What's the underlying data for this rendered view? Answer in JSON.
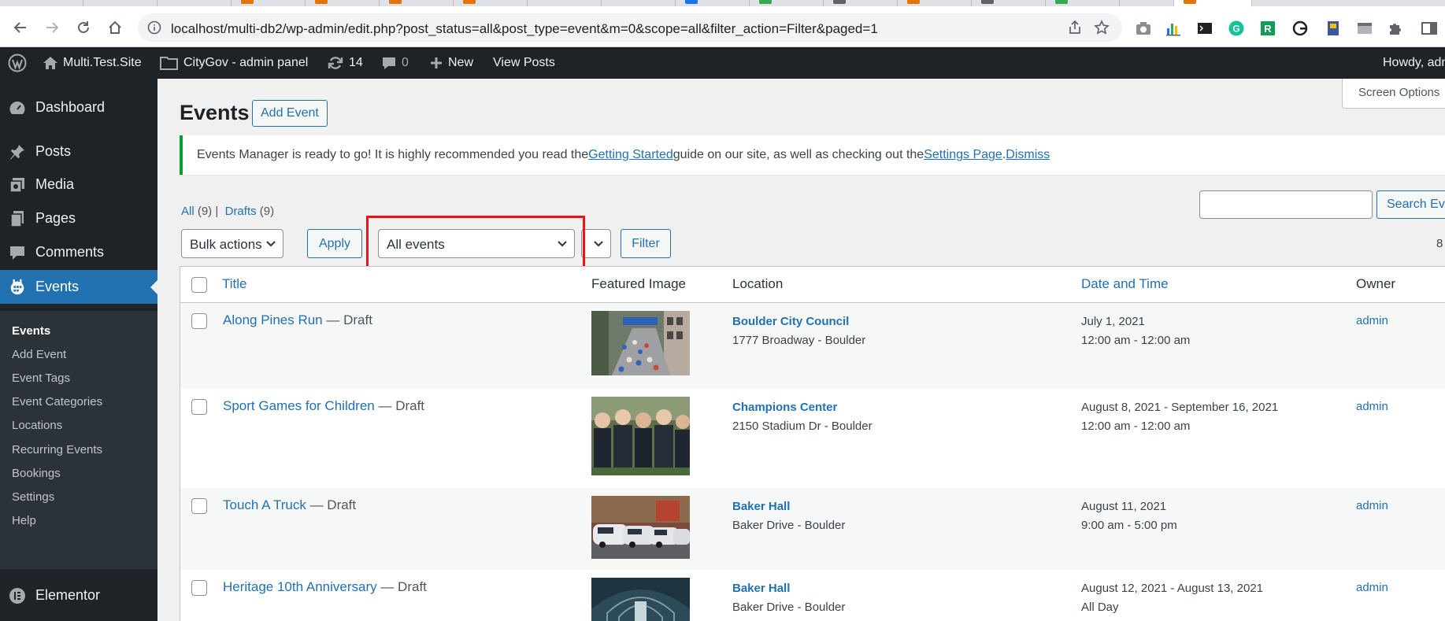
{
  "browser": {
    "url": "localhost/multi-db2/wp-admin/edit.php?post_status=all&post_type=event&m=0&scope=all&filter_action=Filter&paged=1",
    "tab_favicon_colors": [
      "#e37400",
      "#e37400",
      "#e37400",
      "#e37400",
      "#1a73e8",
      "#1a73e8",
      "#34a853",
      "#5f6368",
      "#e37400",
      "#e37400",
      "#5f6368",
      "#34a853",
      "#e37400"
    ]
  },
  "adminbar": {
    "site_name": "Multi.Test.Site",
    "network_label": "CityGov - admin panel",
    "updates_count": "14",
    "comments_count": "0",
    "new_label": "New",
    "view_posts_label": "View Posts",
    "howdy": "Howdy, adm"
  },
  "sidebar": {
    "items": [
      {
        "label": "Dashboard",
        "icon": "dashboard-icon"
      },
      {
        "label": "Posts",
        "icon": "pushpin-icon"
      },
      {
        "label": "Media",
        "icon": "media-icon"
      },
      {
        "label": "Pages",
        "icon": "pages-icon"
      },
      {
        "label": "Comments",
        "icon": "comment-icon"
      },
      {
        "label": "Events",
        "icon": "events-icon"
      },
      {
        "label": "Elementor",
        "icon": "elementor-icon"
      }
    ],
    "submenu": [
      "Events",
      "Add Event",
      "Event Tags",
      "Event Categories",
      "Locations",
      "Recurring Events",
      "Bookings",
      "Settings",
      "Help"
    ]
  },
  "page": {
    "screen_options": "Screen Options",
    "title": "Events",
    "add_button": "Add Event",
    "notice": {
      "text_1": "Events Manager is ready to go! It is highly recommended you read the ",
      "link_1": "Getting Started",
      "text_2": " guide on our site, as well as checking out the ",
      "link_2": "Settings Page",
      "text_3": ". ",
      "dismiss": "Dismiss"
    },
    "views": {
      "all": "All",
      "all_count": "(9)",
      "drafts": "Drafts",
      "drafts_count": "(9)",
      "separator": "|"
    },
    "search_button": "Search Eve",
    "bulk_actions": "Bulk actions",
    "apply": "Apply",
    "scope_select": "All events",
    "filter": "Filter",
    "items_count": "8"
  },
  "table": {
    "columns": [
      "Title",
      "Featured Image",
      "Location",
      "Date and Time",
      "Owner"
    ],
    "rows": [
      {
        "title": "Along Pines Run",
        "state": " — Draft",
        "location_name": "Boulder City Council",
        "location_address": "1777 Broadway - Boulder",
        "date": "July 1, 2021",
        "time": "12:00 am - 12:00 am",
        "owner": "admin"
      },
      {
        "title": "Sport Games for Children",
        "state": " — Draft",
        "location_name": "Champions Center",
        "location_address": "2150 Stadium Dr - Boulder",
        "date": "August 8, 2021 - September 16, 2021",
        "time": "12:00 am - 12:00 am",
        "owner": "admin"
      },
      {
        "title": "Touch A Truck",
        "state": " — Draft",
        "location_name": "Baker Hall",
        "location_address": "Baker Drive - Boulder",
        "date": "August 11, 2021",
        "time": "9:00 am - 5:00 pm",
        "owner": "admin"
      },
      {
        "title": "Heritage 10th Anniversary",
        "state": " — Draft",
        "location_name": "Baker Hall",
        "location_address": "Baker Drive - Boulder",
        "date": "August 12, 2021 - August 13, 2021",
        "time": "All Day",
        "owner": "admin"
      }
    ]
  },
  "colors": {
    "wp_dark": "#1d2327",
    "wp_blue": "#2271b1",
    "notice_green": "#00a32a",
    "highlight_red": "#e8131b"
  }
}
